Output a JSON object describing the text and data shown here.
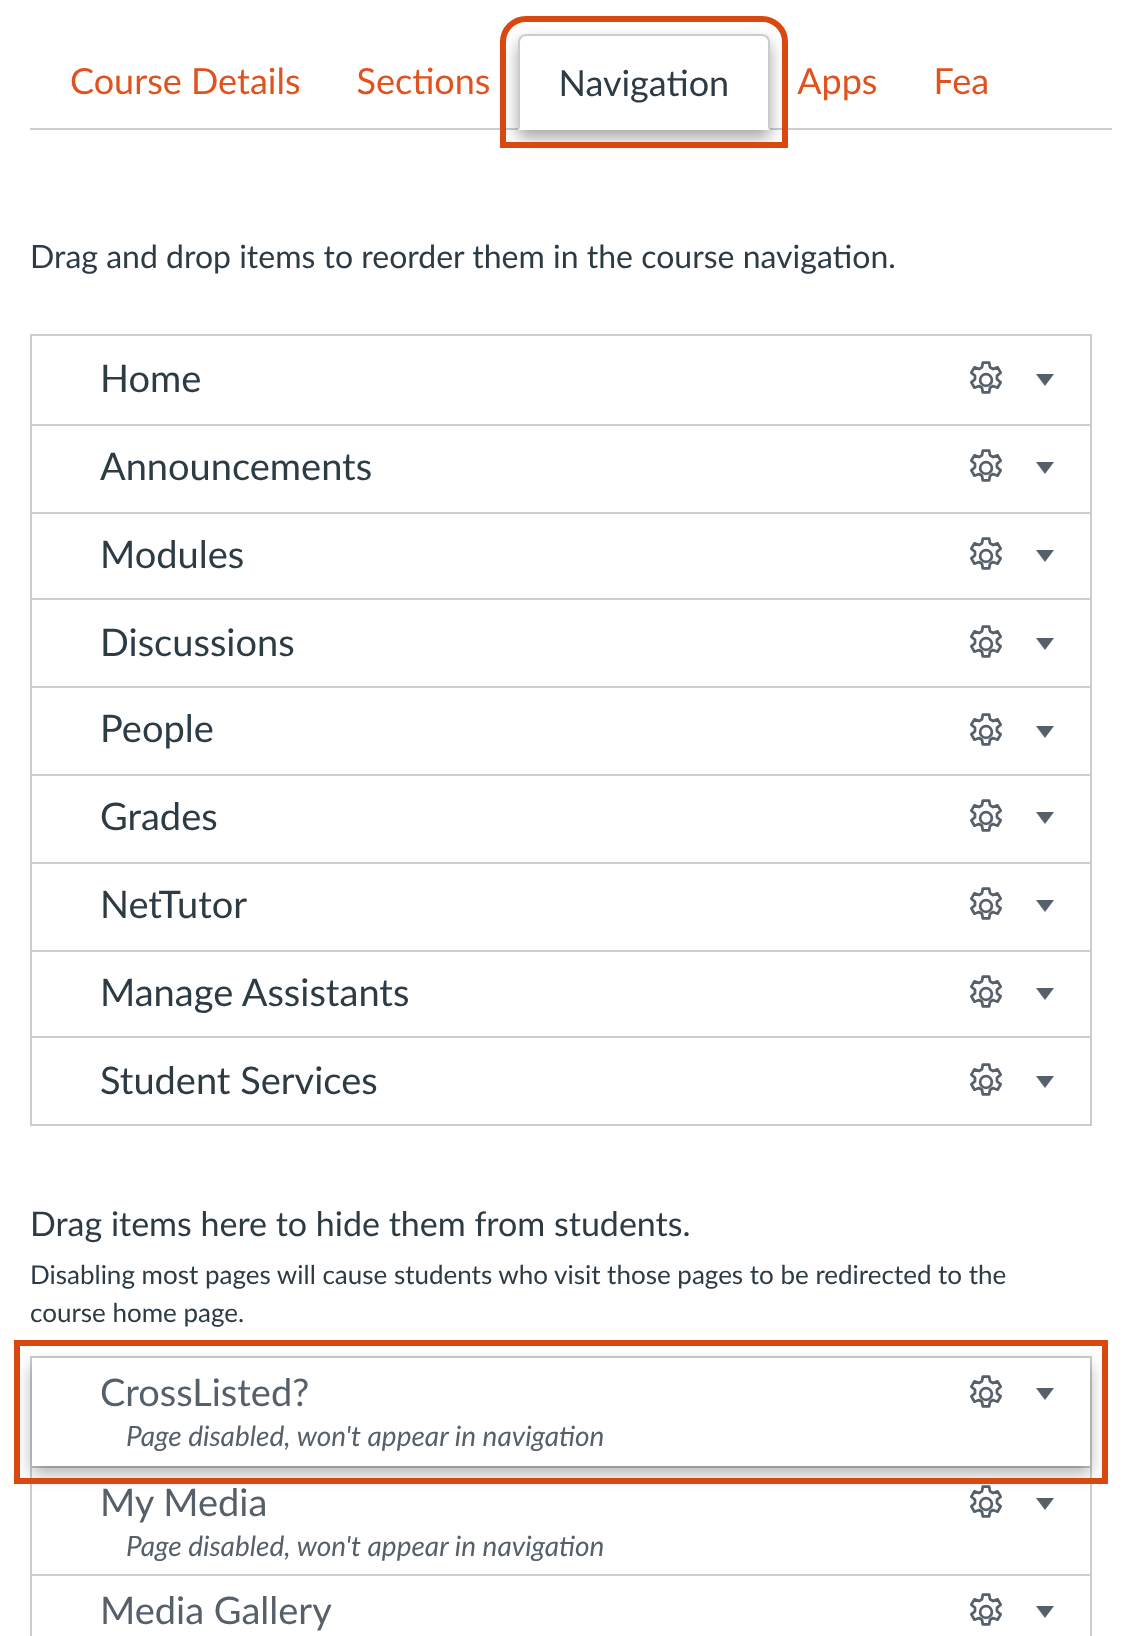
{
  "tabs": [
    {
      "label": "Course Details",
      "selected": false,
      "highlighted": false
    },
    {
      "label": "Sections",
      "selected": false,
      "highlighted": false
    },
    {
      "label": "Navigation",
      "selected": true,
      "highlighted": true
    },
    {
      "label": "Apps",
      "selected": false,
      "highlighted": false
    },
    {
      "label": "Fea",
      "selected": false,
      "highlighted": false
    }
  ],
  "enabled_instructions": "Drag and drop items to reorder them in the course navigation.",
  "enabled_items": [
    {
      "label": "Home"
    },
    {
      "label": "Announcements"
    },
    {
      "label": "Modules"
    },
    {
      "label": "Discussions"
    },
    {
      "label": "People"
    },
    {
      "label": "Grades"
    },
    {
      "label": "NetTutor"
    },
    {
      "label": "Manage Assistants"
    },
    {
      "label": "Student Services"
    }
  ],
  "disabled_instructions": "Drag items here to hide them from students.",
  "disabled_note": "Disabling most pages will cause students who visit those pages to be redirected to the course home page.",
  "disabled_items": [
    {
      "label": "CrossListed?",
      "status": "Page disabled, won't appear in navigation",
      "highlighted": true
    },
    {
      "label": "My Media",
      "status": "Page disabled, won't appear in navigation",
      "highlighted": false
    },
    {
      "label": "Media Gallery",
      "highlighted": false
    }
  ]
}
